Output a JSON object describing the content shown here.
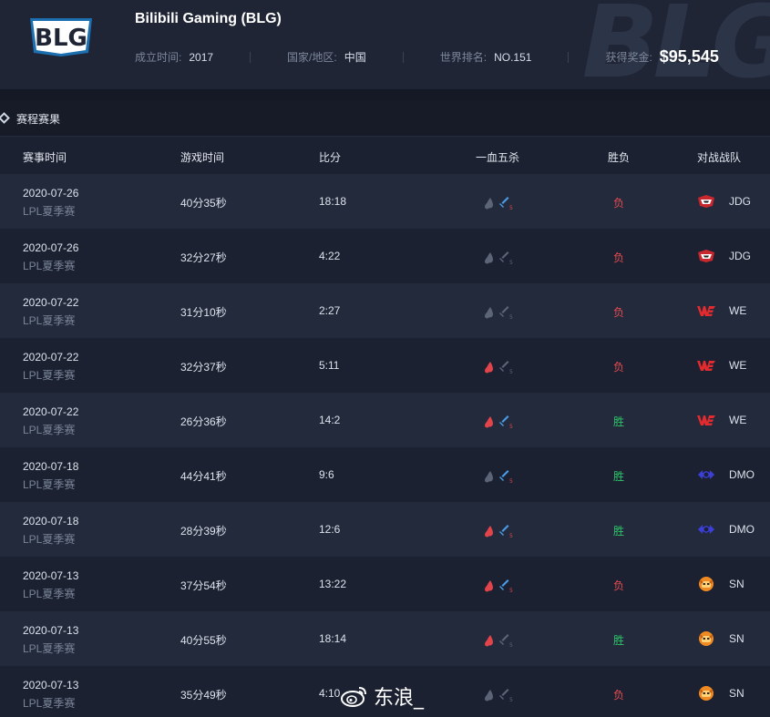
{
  "header": {
    "watermark": "BLG",
    "logo_text": "BLG",
    "team_name": "Bilibili Gaming (BLG)",
    "info": [
      {
        "label": "成立时间:",
        "value": "2017"
      },
      {
        "label": "国家/地区:",
        "value": "中国"
      },
      {
        "label": "世界排名:",
        "value": "NO.151"
      },
      {
        "label": "获得奖金:",
        "value": "$95,545"
      }
    ]
  },
  "section": {
    "title": "赛程赛果"
  },
  "table": {
    "headers": [
      "赛事时间",
      "游戏时间",
      "比分",
      "一血五杀",
      "胜负",
      "对战战队"
    ],
    "rows": [
      {
        "date": "2020-07-26",
        "league": "LPL夏季赛",
        "duration": "40分35秒",
        "score": "18:18",
        "first_blood": false,
        "penta": true,
        "result": "负",
        "win": false,
        "opponent": "JDG",
        "opp_logo": "jdg-logo"
      },
      {
        "date": "2020-07-26",
        "league": "LPL夏季赛",
        "duration": "32分27秒",
        "score": "4:22",
        "first_blood": false,
        "penta": false,
        "result": "负",
        "win": false,
        "opponent": "JDG",
        "opp_logo": "jdg-logo"
      },
      {
        "date": "2020-07-22",
        "league": "LPL夏季赛",
        "duration": "31分10秒",
        "score": "2:27",
        "first_blood": false,
        "penta": false,
        "result": "负",
        "win": false,
        "opponent": "WE",
        "opp_logo": "we-logo"
      },
      {
        "date": "2020-07-22",
        "league": "LPL夏季赛",
        "duration": "32分37秒",
        "score": "5:11",
        "first_blood": true,
        "penta": false,
        "result": "负",
        "win": false,
        "opponent": "WE",
        "opp_logo": "we-logo"
      },
      {
        "date": "2020-07-22",
        "league": "LPL夏季赛",
        "duration": "26分36秒",
        "score": "14:2",
        "first_blood": true,
        "penta": true,
        "result": "胜",
        "win": true,
        "opponent": "WE",
        "opp_logo": "we-logo"
      },
      {
        "date": "2020-07-18",
        "league": "LPL夏季赛",
        "duration": "44分41秒",
        "score": "9:6",
        "first_blood": false,
        "penta": true,
        "result": "胜",
        "win": true,
        "opponent": "DMO",
        "opp_logo": "dmo-logo"
      },
      {
        "date": "2020-07-18",
        "league": "LPL夏季赛",
        "duration": "28分39秒",
        "score": "12:6",
        "first_blood": true,
        "penta": true,
        "result": "胜",
        "win": true,
        "opponent": "DMO",
        "opp_logo": "dmo-logo"
      },
      {
        "date": "2020-07-13",
        "league": "LPL夏季赛",
        "duration": "37分54秒",
        "score": "13:22",
        "first_blood": true,
        "penta": true,
        "result": "负",
        "win": false,
        "opponent": "SN",
        "opp_logo": "sn-logo"
      },
      {
        "date": "2020-07-13",
        "league": "LPL夏季赛",
        "duration": "40分55秒",
        "score": "18:14",
        "first_blood": true,
        "penta": false,
        "result": "胜",
        "win": true,
        "opponent": "SN",
        "opp_logo": "sn-logo"
      },
      {
        "date": "2020-07-13",
        "league": "LPL夏季赛",
        "duration": "35分49秒",
        "score": "4:10",
        "first_blood": false,
        "penta": false,
        "result": "负",
        "win": false,
        "opponent": "SN",
        "opp_logo": "sn-logo"
      }
    ]
  },
  "watermark_overlay": {
    "text": "东浪_",
    "icon": "weibo-icon"
  },
  "colors": {
    "loss": "#ea4b52",
    "win": "#2fc76b",
    "first_blood_active": "#e2444c",
    "penta_active": "#4a9be8",
    "icon_inactive": "#5c6577"
  }
}
